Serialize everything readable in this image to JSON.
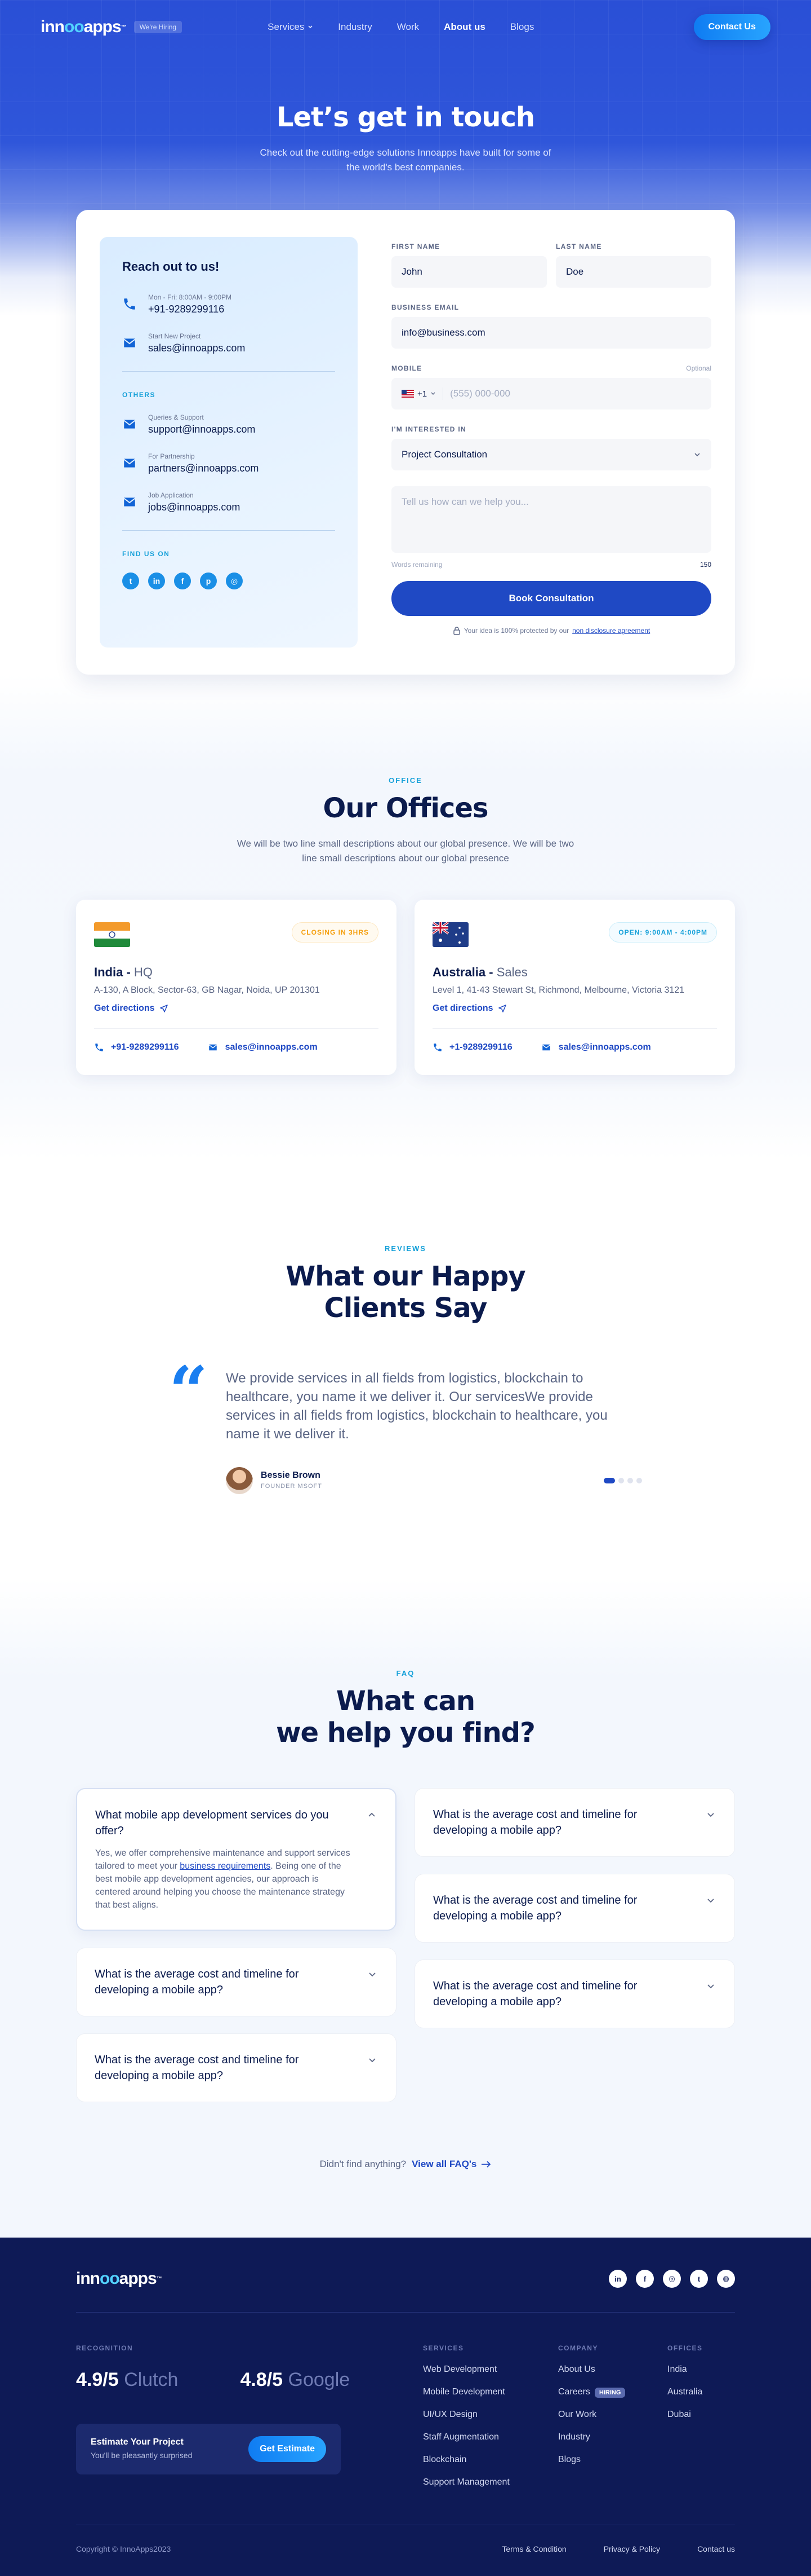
{
  "nav": {
    "logo_a": "inn",
    "logo_b": "oo",
    "logo_c": "apps",
    "logo_tm": "™",
    "hiring": "We're Hiring",
    "items": [
      "Services",
      "Industry",
      "Work",
      "About us",
      "Blogs"
    ],
    "cta": "Contact Us"
  },
  "hero": {
    "title": "Let’s get in touch",
    "subtitle": "Check out the cutting-edge solutions Innoapps have built for some of the world's best companies."
  },
  "reach": {
    "title": "Reach out to us!",
    "primary": [
      {
        "label": "Mon - Fri: 8:00AM - 9:00PM",
        "value": "+91-9289299116",
        "icon": "phone-icon"
      },
      {
        "label": "Start New Project",
        "value": "sales@innoapps.com",
        "icon": "mail-icon"
      }
    ],
    "others_label": "OTHERS",
    "others": [
      {
        "label": "Queries & Support",
        "value": "support@innoapps.com",
        "icon": "mail-icon"
      },
      {
        "label": "For Partnership",
        "value": "partners@innoapps.com",
        "icon": "mail-icon"
      },
      {
        "label": "Job Application",
        "value": "jobs@innoapps.com",
        "icon": "mail-icon"
      }
    ],
    "find_label": "FIND US ON",
    "socials": [
      "twitter-icon",
      "linkedin-icon",
      "facebook-icon",
      "pinterest-icon",
      "instagram-icon"
    ]
  },
  "form": {
    "first_name_label": "FIRST NAME",
    "first_name_value": "John",
    "last_name_label": "LAST NAME",
    "last_name_value": "Doe",
    "email_label": "BUSINESS EMAIL",
    "email_value": "info@business.com",
    "mobile_label": "MOBILE",
    "mobile_optional": "Optional",
    "country_code": "+1",
    "mobile_placeholder": "(555) 000-000",
    "interest_label": "I'M INTERESTED IN",
    "interest_value": "Project Consultation",
    "message_placeholder": "Tell us how can we help you...",
    "words_label": "Words remaining",
    "words_count": "150",
    "submit": "Book Consultation",
    "nda_text": "Your idea is 100% protected by our",
    "nda_link": "non disclosure agreement"
  },
  "offices": {
    "tag": "OFFICE",
    "title": "Our Offices",
    "subtitle": "We will be two line small descriptions about our global presence. We will be two line small descriptions about our global presence",
    "cards": [
      {
        "country": "India",
        "type": "HQ",
        "badge": "CLOSING IN 3HRS",
        "address": "A-130, A Block, Sector-63, GB Nagar, Noida, UP 201301",
        "directions": "Get directions",
        "phone": "+91-9289299116",
        "email": "sales@innoapps.com"
      },
      {
        "country": "Australia",
        "type": "Sales",
        "badge": "OPEN: 9:00AM - 4:00PM",
        "address": "Level 1, 41-43 Stewart St, Richmond, Melbourne, Victoria 3121",
        "directions": "Get directions",
        "phone": "+1-9289299116",
        "email": "sales@innoapps.com"
      }
    ]
  },
  "reviews": {
    "tag": "REVIEWS",
    "title_1": "What our Happy",
    "title_2": "Clients Say",
    "quote": "We provide services in all fields from logistics, blockchain to healthcare, you name it we deliver it. Our servicesWe provide services in all fields from logistics, blockchain to healthcare, you name it we deliver it.",
    "name": "Bessie Brown",
    "role": "FOUNDER MSOFT"
  },
  "faq": {
    "tag": "FAQ",
    "title_1": "What can",
    "title_2": "we help you find?",
    "open_q": "What mobile app development services do you offer?",
    "open_a_1": "Yes, we offer comprehensive maintenance and support services tailored to meet your ",
    "open_a_link": "business requirements",
    "open_a_2": ". Being one of the best mobile app development agencies, our approach is centered around helping you choose the maintenance strategy that best aligns.",
    "q": "What is the average cost and timeline for developing a mobile app?",
    "more_text": "Didn't find anything?",
    "more_link": "View all FAQ's"
  },
  "footer": {
    "recognition_label": "RECOGNITION",
    "rating1": "4.9/5",
    "rating1_src": "Clutch",
    "rating2": "4.8/5",
    "rating2_src": "Google",
    "est_title": "Estimate Your Project",
    "est_sub": "You'll be pleasantly surprised",
    "est_btn": "Get Estimate",
    "services_label": "SERVICES",
    "services": [
      "Web Development",
      "Mobile Development",
      "UI/UX Design",
      "Staff Augmentation",
      "Blockchain",
      "Support Management"
    ],
    "company_label": "COMPANY",
    "company": [
      "About Us",
      "Careers",
      "Our Work",
      "Industry",
      "Blogs"
    ],
    "hiring_pill": "HIRING",
    "offices_label": "OFFICES",
    "offices": [
      "India",
      "Australia",
      "Dubai"
    ],
    "copyright": "Copyright © InnoApps2023",
    "links": [
      "Terms & Condition",
      "Privacy & Policy",
      "Contact us"
    ]
  },
  "colors": {
    "primary": "#1f49c4",
    "accent": "#17a1d9",
    "navy": "#0e1a56"
  }
}
